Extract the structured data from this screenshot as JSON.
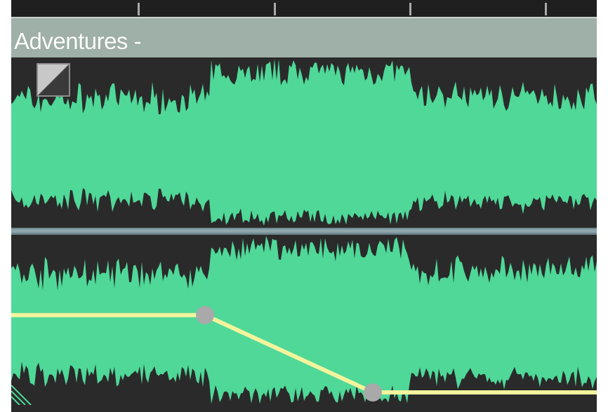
{
  "clip": {
    "title": "Adventures -",
    "waveform_color": "#4fd898",
    "background_color": "#2a2a2a",
    "header_color": "#9fb0a8",
    "fx_badge_icon": "effect-badge-icon"
  },
  "volume_envelope": {
    "line_color": "#f3f49c",
    "keyframe_color": "#a9a9a9",
    "keyframes": [
      {
        "label": "keyframe-1",
        "level": 0.37
      },
      {
        "label": "keyframe-2",
        "level": 0.0
      }
    ]
  }
}
